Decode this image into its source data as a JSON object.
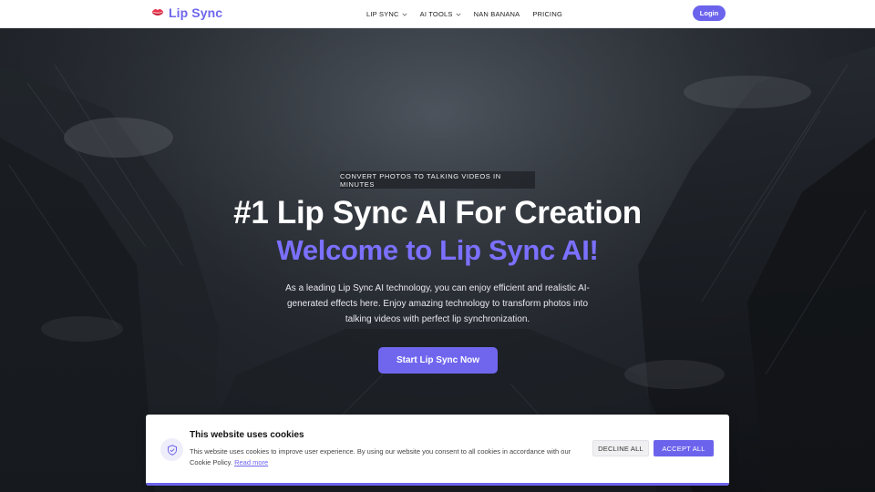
{
  "brand": {
    "name": "Lip Sync",
    "color": "#6e66ee",
    "icon": "lips-icon"
  },
  "nav": {
    "items": [
      {
        "label": "LIP SYNC",
        "dropdown": true
      },
      {
        "label": "AI TOOLS",
        "dropdown": true
      },
      {
        "label": "NAN BANANA",
        "dropdown": false
      },
      {
        "label": "PRICING",
        "dropdown": false
      }
    ],
    "login_label": "Login"
  },
  "hero": {
    "eyebrow": "CONVERT PHOTOS TO TALKING VIDEOS IN MINUTES",
    "title": "#1 Lip Sync AI For Creation",
    "subtitle": "Welcome to Lip Sync AI!",
    "description": "As a leading Lip Sync AI technology, you can enjoy efficient and realistic AI-generated effects here. Enjoy amazing technology to transform photos into talking videos with perfect lip synchronization.",
    "cta_label": "Start Lip Sync Now"
  },
  "cookie": {
    "title": "This website uses cookies",
    "text": "This website uses cookies to improve user experience. By using our website you consent to all cookies in accordance with our Cookie Policy.",
    "link_label": "Read more",
    "decline_label": "DECLINE ALL",
    "accept_label": "ACCEPT ALL"
  },
  "colors": {
    "accent": "#6c63ed",
    "subtitle": "#7b70ff"
  }
}
